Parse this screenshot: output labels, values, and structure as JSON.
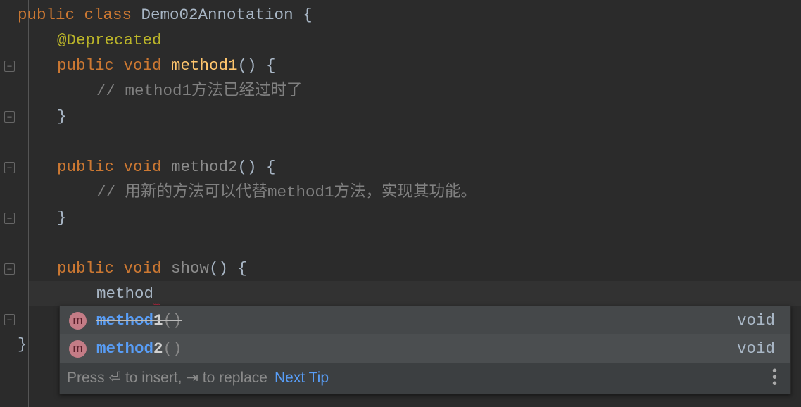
{
  "code": {
    "l1": {
      "kw": "public class ",
      "name": "Demo02Annotation {"
    },
    "l2": "@Deprecated",
    "l3": {
      "kw": "public void ",
      "fn": "method1",
      "rest": "() {"
    },
    "l4": "// method1方法已经过时了",
    "l5": "}",
    "l7": {
      "kw": "public void ",
      "fn": "method2",
      "rest": "() {"
    },
    "l8": "// 用新的方法可以代替method1方法，实现其功能。",
    "l9": "}",
    "l11": {
      "kw": "public void ",
      "fn": "show",
      "rest": "() {"
    },
    "l12": "method",
    "l14": "}"
  },
  "completion": {
    "items": [
      {
        "match": "method",
        "rest": "1",
        "params": "()",
        "type": "void",
        "deprecated": true
      },
      {
        "match": "method",
        "rest": "2",
        "params": "()",
        "type": "void",
        "deprecated": false
      }
    ],
    "icon_letter": "m",
    "footer": "Press ⏎ to insert, ⇥ to replace",
    "next_tip": "Next Tip",
    "colors": {
      "match": "#589df6",
      "icon": "#c47c86"
    }
  }
}
